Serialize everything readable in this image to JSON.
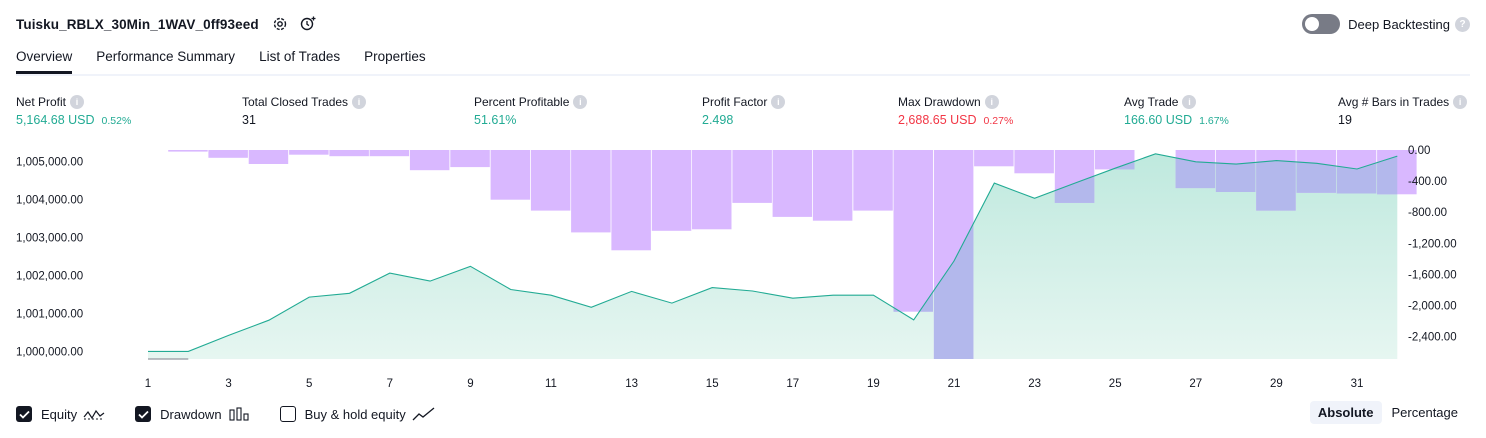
{
  "header": {
    "title": "Tuisku_RBLX_30Min_1WAV_0ff93eed",
    "deep_backtesting_label": "Deep Backtesting",
    "deep_backtesting_enabled": false
  },
  "tabs": [
    {
      "label": "Overview",
      "active": true
    },
    {
      "label": "Performance Summary",
      "active": false
    },
    {
      "label": "List of Trades",
      "active": false
    },
    {
      "label": "Properties",
      "active": false
    }
  ],
  "metrics": {
    "net_profit": {
      "label": "Net Profit",
      "value": "5,164.68 USD",
      "pct": "0.52%"
    },
    "total_closed_trades": {
      "label": "Total Closed Trades",
      "value": "31"
    },
    "percent_profitable": {
      "label": "Percent Profitable",
      "value": "51.61%"
    },
    "profit_factor": {
      "label": "Profit Factor",
      "value": "2.498"
    },
    "max_drawdown": {
      "label": "Max Drawdown",
      "value": "2,688.65 USD",
      "pct": "0.27%"
    },
    "avg_trade": {
      "label": "Avg Trade",
      "value": "166.60 USD",
      "pct": "1.67%"
    },
    "avg_bars": {
      "label": "Avg # Bars in Trades",
      "value": "19"
    }
  },
  "chart_data": {
    "type": "area",
    "x": [
      1,
      2,
      3,
      4,
      5,
      6,
      7,
      8,
      9,
      10,
      11,
      12,
      13,
      14,
      15,
      16,
      17,
      18,
      19,
      20,
      21,
      22,
      23,
      24,
      25,
      26,
      27,
      28,
      29,
      30,
      31,
      32
    ],
    "x_tick_labels": [
      "1",
      "3",
      "5",
      "7",
      "9",
      "11",
      "13",
      "15",
      "17",
      "19",
      "21",
      "23",
      "25",
      "27",
      "29",
      "31"
    ],
    "left_axis": {
      "ticks": [
        "1,000,000.00",
        "1,001,000.00",
        "1,002,000.00",
        "1,003,000.00",
        "1,004,000.00",
        "1,005,000.00"
      ],
      "range": [
        999800,
        1005300
      ]
    },
    "right_axis": {
      "ticks": [
        "0.00",
        "-400.00",
        "-800.00",
        "-1,200.00",
        "-1,600.00",
        "-2,000.00",
        "-2,400.00"
      ],
      "range": [
        -2688.65,
        0
      ]
    },
    "series": [
      {
        "type": "area",
        "values": [
          1000000,
          1000000,
          1000420,
          1000820,
          1001430,
          1001530,
          1002060,
          1001850,
          1002240,
          1001630,
          1001480,
          1001160,
          1001580,
          1001270,
          1001680,
          1001590,
          1001400,
          1001480,
          1001480,
          1000830,
          1002380,
          1004430,
          1004030,
          1004430,
          1004820,
          1005200,
          1004990,
          1004930,
          1005020,
          1004950,
          1004800,
          1005140
        ]
      },
      {
        "type": "bar",
        "values": [
          0,
          -20,
          -100,
          -180,
          -60,
          -80,
          -80,
          -260,
          -220,
          -640,
          -780,
          -1060,
          -1290,
          -1040,
          -1020,
          -680,
          -860,
          -910,
          -780,
          -2080,
          -2688.65,
          -210,
          -300,
          -680,
          -250,
          0,
          -490,
          -540,
          -780,
          -550,
          -560,
          -570
        ]
      }
    ],
    "colors": {
      "equity": "#22ab94",
      "equity_fill": "#cdeee4",
      "drawdown": "#d9b8ff",
      "drawdown_over_equity": "#b3b8ec"
    }
  },
  "legend": [
    {
      "label": "Equity",
      "checked": true,
      "icon": "equity-line-icon"
    },
    {
      "label": "Drawdown",
      "checked": true,
      "icon": "drawdown-bars-icon"
    },
    {
      "label": "Buy & hold equity",
      "checked": false,
      "icon": "buy-hold-line-icon"
    }
  ],
  "modes": [
    {
      "label": "Absolute",
      "active": true
    },
    {
      "label": "Percentage",
      "active": false
    }
  ]
}
